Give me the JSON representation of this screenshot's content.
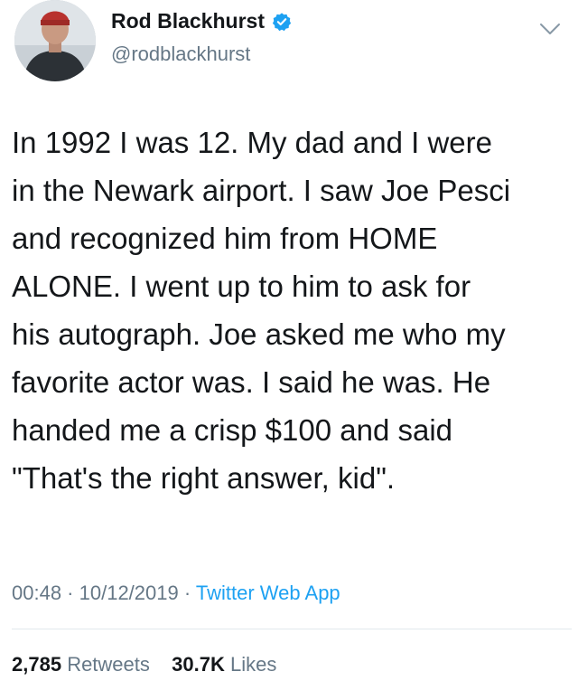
{
  "author": {
    "display_name": "Rod Blackhurst",
    "handle": "@rodblackhurst",
    "verified": true
  },
  "tweet": {
    "lines": [
      "In 1992 I was 12. My dad and I were",
      "in the Newark airport. I saw Joe Pesci",
      "and recognized him from HOME",
      "ALONE. I went up to him to ask for",
      "his autograph. Joe asked me who my",
      "favorite actor was. I said he was. He",
      "handed me a crisp $100 and said",
      "\"That's the right answer, kid\"."
    ]
  },
  "meta": {
    "time": "00:48",
    "separator": " · ",
    "date": "10/12/2019",
    "source": "Twitter Web App"
  },
  "stats": {
    "retweets_count": "2,785",
    "retweets_label": "Retweets",
    "likes_count": "30.7K",
    "likes_label": "Likes"
  },
  "colors": {
    "text": "#14171a",
    "secondary": "#657786",
    "accent": "#1da1f2",
    "divider": "#e1e8ed"
  },
  "icons": {
    "verified": "verified-badge-icon",
    "menu": "chevron-down-icon"
  }
}
